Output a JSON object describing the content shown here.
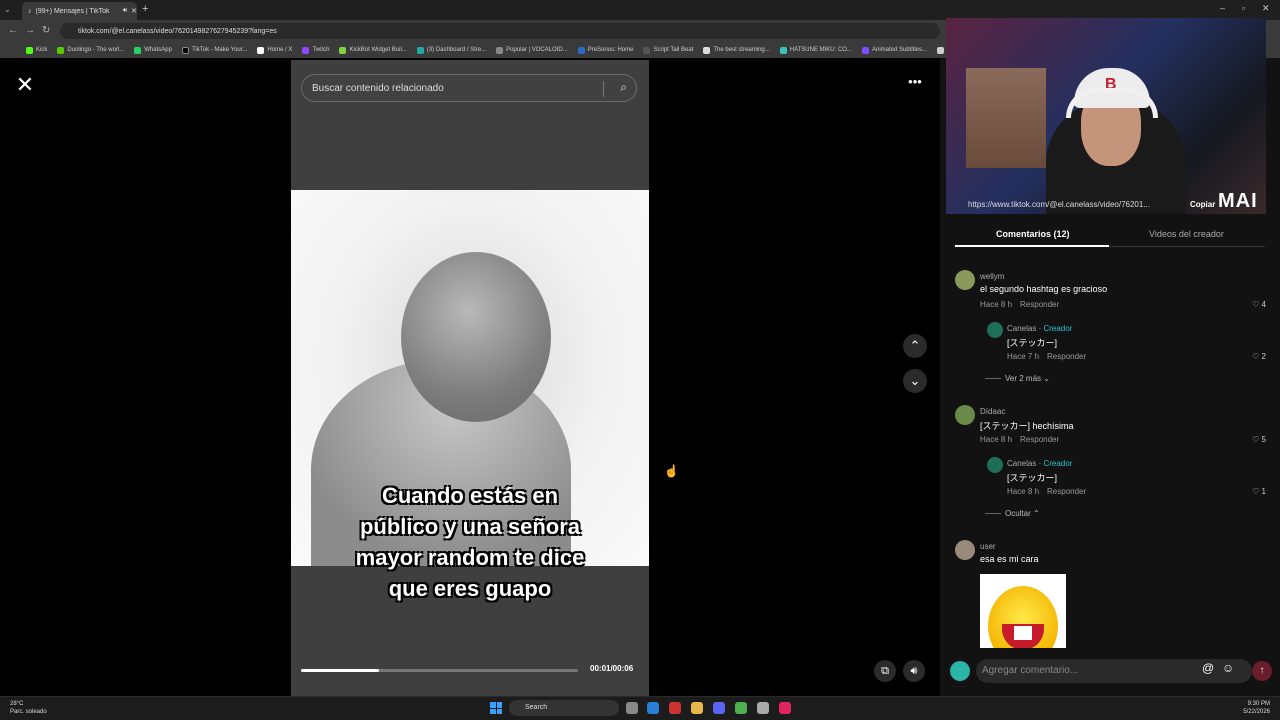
{
  "browser": {
    "tab_title": "(99+) Mensajes | TikTok",
    "url": "tiktok.com/@el.canelass/video/7620149827627945239?lang=es",
    "bookmarks": [
      "Kick",
      "Duolingo - The worl...",
      "WhatsApp",
      "TikTok - Make Your...",
      "Home / X",
      "Twitch",
      "KickBot Widget Buil...",
      "(3) Dashboard / Stre...",
      "Popular | VOCALOID...",
      "PreSonus: Home",
      "Script Tail Beat",
      "The best streaming...",
      "HATSUNE MIKU: CO...",
      "Animated Subtitles...",
      "HA"
    ]
  },
  "video": {
    "search_placeholder": "Buscar contenido relacionado",
    "caption": [
      "Cuando estás en",
      "público y una señora",
      "mayor random te dice",
      "que eres guapo"
    ],
    "time": "00:01/00:06",
    "progress": 0.28
  },
  "stream_overlay": {
    "url": "https://www.tiktok.com/@el.canelass/video/76201...",
    "copy": "Copiar",
    "brand": "MAI"
  },
  "panel": {
    "tab_comments": "Comentarios (12)",
    "tab_creator": "Videos del creador",
    "comments": [
      {
        "user": "wellym",
        "text": "el segundo hashtag es gracioso",
        "time": "Hace 8 h",
        "reply": "Responder",
        "likes": "4"
      },
      {
        "user": "Canelas",
        "creator": "Creador",
        "text": "[ステッカー]",
        "time": "Hace 7 h",
        "reply": "Responder",
        "likes": "2"
      },
      {
        "more": "Ver 2 más"
      },
      {
        "user": "Dídaac",
        "text": "[ステッカー] hechísima",
        "time": "Hace 8 h",
        "reply": "Responder",
        "likes": "5"
      },
      {
        "user": "Canelas",
        "creator": "Creador",
        "text": "[ステッカー]",
        "time": "Hace 8 h",
        "reply": "Responder",
        "likes": "1"
      },
      {
        "more": "Ocultar"
      },
      {
        "user": "user",
        "text": "esa es mi cara"
      }
    ],
    "add_comment_placeholder": "Agregar comentario..."
  },
  "taskbar": {
    "temp": "28°C",
    "weather": "Parc. soleado",
    "search": "Search",
    "time": "9:30 PM",
    "date": "5/22/2026"
  },
  "colors": {
    "creator": "#2bc3d2",
    "send": "#6a1d2a"
  }
}
